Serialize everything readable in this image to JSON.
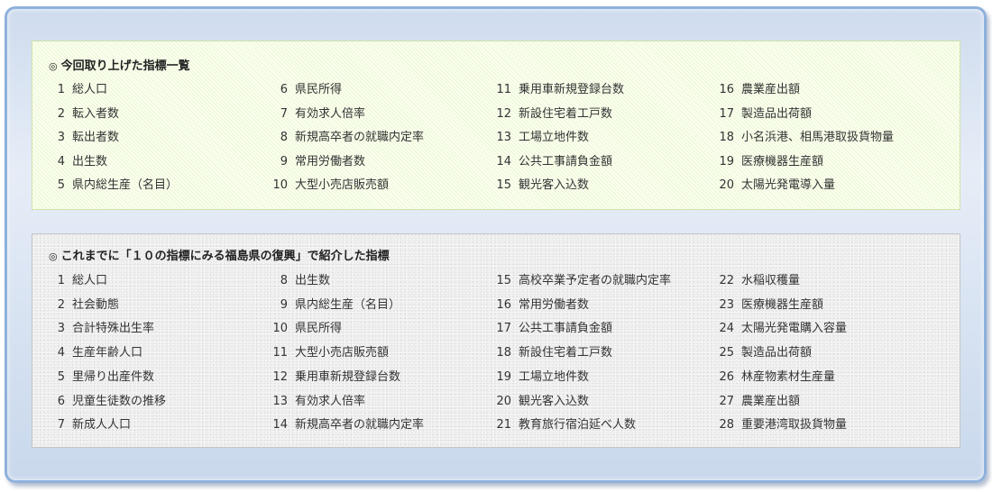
{
  "current": {
    "mark": "◎",
    "title": "今回取り上げた指標一覧",
    "items": [
      {
        "num": "1",
        "label": "総人口"
      },
      {
        "num": "2",
        "label": "転入者数"
      },
      {
        "num": "3",
        "label": "転出者数"
      },
      {
        "num": "4",
        "label": "出生数"
      },
      {
        "num": "5",
        "label": "県内総生産（名目）"
      },
      {
        "num": "6",
        "label": "県民所得"
      },
      {
        "num": "7",
        "label": "有効求人倍率"
      },
      {
        "num": "8",
        "label": "新規高卒者の就職内定率"
      },
      {
        "num": "9",
        "label": "常用労働者数"
      },
      {
        "num": "10",
        "label": "大型小売店販売額"
      },
      {
        "num": "11",
        "label": "乗用車新規登録台数"
      },
      {
        "num": "12",
        "label": "新設住宅着工戸数"
      },
      {
        "num": "13",
        "label": "工場立地件数"
      },
      {
        "num": "14",
        "label": "公共工事請負金額"
      },
      {
        "num": "15",
        "label": "観光客入込数"
      },
      {
        "num": "16",
        "label": "農業産出額"
      },
      {
        "num": "17",
        "label": "製造品出荷額"
      },
      {
        "num": "18",
        "label": "小名浜港、相馬港取扱貨物量"
      },
      {
        "num": "19",
        "label": "医療機器生産額"
      },
      {
        "num": "20",
        "label": "太陽光発電導入量"
      }
    ]
  },
  "past": {
    "mark": "◎",
    "title": "これまでに「１０の指標にみる福島県の復興」で紹介した指標",
    "items": [
      {
        "num": "1",
        "label": "総人口"
      },
      {
        "num": "2",
        "label": "社会動態"
      },
      {
        "num": "3",
        "label": "合計特殊出生率"
      },
      {
        "num": "4",
        "label": "生産年齢人口"
      },
      {
        "num": "5",
        "label": "里帰り出産件数"
      },
      {
        "num": "6",
        "label": "児童生徒数の推移"
      },
      {
        "num": "7",
        "label": "新成人人口"
      },
      {
        "num": "8",
        "label": "出生数"
      },
      {
        "num": "9",
        "label": "県内総生産（名目）"
      },
      {
        "num": "10",
        "label": "県民所得"
      },
      {
        "num": "11",
        "label": "大型小売店販売額"
      },
      {
        "num": "12",
        "label": "乗用車新規登録台数"
      },
      {
        "num": "13",
        "label": "有効求人倍率"
      },
      {
        "num": "14",
        "label": "新規高卒者の就職内定率"
      },
      {
        "num": "15",
        "label": "高校卒業予定者の就職内定率"
      },
      {
        "num": "16",
        "label": "常用労働者数"
      },
      {
        "num": "17",
        "label": "公共工事請負金額"
      },
      {
        "num": "18",
        "label": "新設住宅着工戸数"
      },
      {
        "num": "19",
        "label": "工場立地件数"
      },
      {
        "num": "20",
        "label": "観光客入込数"
      },
      {
        "num": "21",
        "label": "教育旅行宿泊延べ人数"
      },
      {
        "num": "22",
        "label": "水稲収穫量"
      },
      {
        "num": "23",
        "label": "医療機器生産額"
      },
      {
        "num": "24",
        "label": "太陽光発電購入容量"
      },
      {
        "num": "25",
        "label": "製造品出荷額"
      },
      {
        "num": "26",
        "label": "林産物素材生産量"
      },
      {
        "num": "27",
        "label": "農業産出額"
      },
      {
        "num": "28",
        "label": "重要港湾取扱貨物量"
      }
    ]
  }
}
